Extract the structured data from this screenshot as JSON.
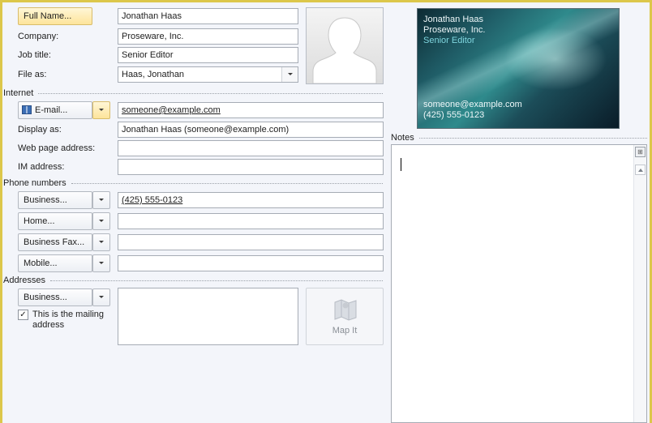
{
  "name": {
    "full_name_button": "Full Name...",
    "full_name_value": "Jonathan Haas",
    "company_label": "Company:",
    "company_value": "Proseware, Inc.",
    "job_title_label": "Job title:",
    "job_title_value": "Senior Editor",
    "file_as_label": "File as:",
    "file_as_value": "Haas, Jonathan"
  },
  "internet": {
    "section_label": "Internet",
    "email_button": "E-mail...",
    "email_value": "someone@example.com",
    "display_as_label": "Display as:",
    "display_as_value": "Jonathan Haas (someone@example.com)",
    "web_page_label": "Web page address:",
    "web_page_value": "",
    "im_label": "IM address:",
    "im_value": ""
  },
  "phones": {
    "section_label": "Phone numbers",
    "rows": [
      {
        "label": "Business...",
        "value": "(425) 555-0123"
      },
      {
        "label": "Home...",
        "value": ""
      },
      {
        "label": "Business Fax...",
        "value": ""
      },
      {
        "label": "Mobile...",
        "value": ""
      }
    ]
  },
  "addresses": {
    "section_label": "Addresses",
    "type_button": "Business...",
    "mailing_checkbox_label": "This is the mailing address",
    "mailing_checked": true,
    "address_value": "",
    "map_it_label": "Map It"
  },
  "business_card": {
    "name": "Jonathan Haas",
    "company": "Proseware, Inc.",
    "title": "Senior Editor",
    "email": "someone@example.com",
    "phone": "(425) 555-0123"
  },
  "notes": {
    "section_label": "Notes",
    "value": ""
  },
  "colors": {
    "frame_border": "#dcc74a",
    "background": "#f3f5fa",
    "card_title_accent": "#7fd6df",
    "button_highlight": "#fde49a"
  },
  "icons": {
    "address_book": "address-book-icon",
    "contact_photo": "person-silhouette",
    "map": "map-icon",
    "notes_tool": "notes-tool-icon",
    "scroll_up": "arrow-up-icon"
  }
}
